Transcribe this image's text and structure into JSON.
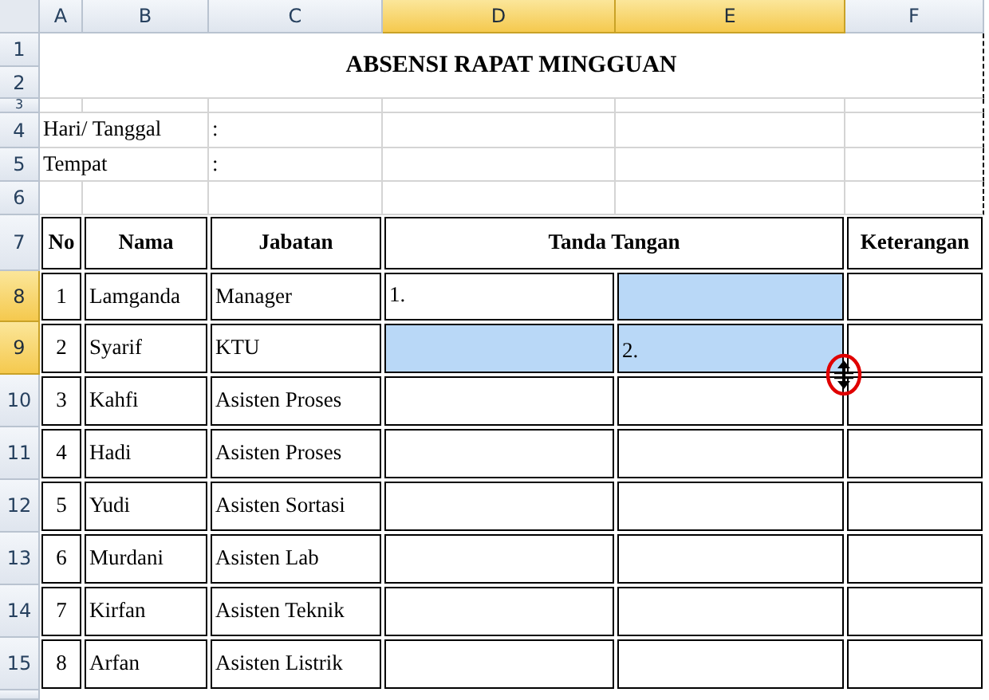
{
  "columns": [
    {
      "label": "A",
      "selected": false
    },
    {
      "label": "B",
      "selected": false
    },
    {
      "label": "C",
      "selected": false
    },
    {
      "label": "D",
      "selected": true
    },
    {
      "label": "E",
      "selected": true
    },
    {
      "label": "F",
      "selected": false
    }
  ],
  "rows": [
    {
      "label": "1",
      "selected": false
    },
    {
      "label": "2",
      "selected": false
    },
    {
      "label": "3",
      "selected": false
    },
    {
      "label": "4",
      "selected": false
    },
    {
      "label": "5",
      "selected": false
    },
    {
      "label": "6",
      "selected": false
    },
    {
      "label": "7",
      "selected": false
    },
    {
      "label": "8",
      "selected": true
    },
    {
      "label": "9",
      "selected": true
    },
    {
      "label": "10",
      "selected": false
    },
    {
      "label": "11",
      "selected": false
    },
    {
      "label": "12",
      "selected": false
    },
    {
      "label": "13",
      "selected": false
    },
    {
      "label": "14",
      "selected": false
    },
    {
      "label": "15",
      "selected": false
    }
  ],
  "title": "ABSENSI RAPAT MINGGUAN",
  "info": [
    {
      "label": "Hari/ Tanggal",
      "separator": ":"
    },
    {
      "label": "Tempat",
      "separator": ":"
    }
  ],
  "table": {
    "headers": [
      "No",
      "Nama",
      "Jabatan",
      "Tanda Tangan",
      "Keterangan"
    ],
    "rows": [
      {
        "no": "1",
        "nama": "Lamganda",
        "jabatan": "Manager",
        "signature": [
          {
            "text": "1.",
            "selected": false
          },
          {
            "selected": true
          }
        ]
      },
      {
        "no": "2",
        "nama": "Syarif",
        "jabatan": "KTU",
        "signature": [
          {
            "selected": true
          },
          {
            "text": "2.",
            "selected": true
          }
        ]
      },
      {
        "no": "3",
        "nama": "Kahfi",
        "jabatan": "Asisten Proses",
        "signature": [
          {
            "selected": false
          },
          {
            "selected": false
          }
        ]
      },
      {
        "no": "4",
        "nama": "Hadi",
        "jabatan": "Asisten Proses",
        "signature": [
          {
            "selected": false
          },
          {
            "selected": false
          }
        ]
      },
      {
        "no": "5",
        "nama": "Yudi",
        "jabatan": "Asisten Sortasi",
        "signature": [
          {
            "selected": false
          },
          {
            "selected": false
          }
        ]
      },
      {
        "no": "6",
        "nama": "Murdani",
        "jabatan": "Asisten Lab",
        "signature": [
          {
            "selected": false
          },
          {
            "selected": false
          }
        ]
      },
      {
        "no": "7",
        "nama": "Kirfan",
        "jabatan": "Asisten Teknik",
        "signature": [
          {
            "selected": false
          },
          {
            "selected": false
          }
        ]
      },
      {
        "no": "8",
        "nama": "Arfan",
        "jabatan": "Asisten Listrik",
        "signature": [
          {
            "selected": false
          },
          {
            "selected": false
          }
        ]
      }
    ]
  }
}
